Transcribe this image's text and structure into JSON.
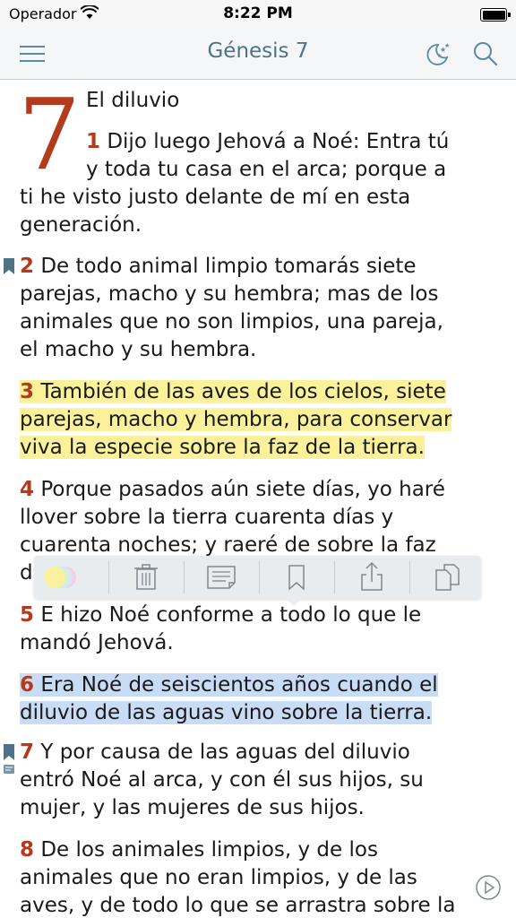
{
  "status_bar": {
    "carrier": "Operador",
    "time": "8:22 PM"
  },
  "navbar": {
    "title": "Génesis 7"
  },
  "chapter": {
    "number": "7",
    "heading": "El diluvio"
  },
  "verses": [
    {
      "num": "1",
      "lines": [
        "Dijo luego Jehová a Noé: Entra tú",
        "y toda tu casa en el arca; porque a",
        "ti he visto justo delante de mí en esta",
        "generación."
      ]
    },
    {
      "num": "2",
      "lines": [
        "De todo animal limpio tomarás siete",
        "parejas, macho y su hembra; mas de los",
        "animales que no son limpios, una pareja,",
        "el macho y su hembra."
      ]
    },
    {
      "num": "3",
      "lines": [
        "También de las aves de los cielos, siete",
        "parejas, macho y hembra, para conservar",
        "viva la especie sobre la faz de la tierra."
      ]
    },
    {
      "num": "4",
      "lines": [
        "Porque pasados aún siete días, yo haré",
        "llover sobre la tierra cuarenta días y",
        "cuarenta noches; y raeré de sobre la faz",
        "d"
      ]
    },
    {
      "num": "5",
      "lines": [
        "E hizo Noé conforme a todo lo que le",
        "mandó Jehová."
      ]
    },
    {
      "num": "6",
      "lines": [
        "Era Noé de seiscientos años cuando el",
        "diluvio de las aguas vino sobre la tierra."
      ]
    },
    {
      "num": "7",
      "lines": [
        "Y por causa de las aguas del diluvio",
        "entró Noé al arca, y con él sus hijos, su",
        "mujer, y las mujeres de sus hijos."
      ]
    },
    {
      "num": "8",
      "lines": [
        "De los animales limpios, y de los",
        "animales que no eran limpios, y de las",
        "aves, y de todo lo que se arrastra sobre la"
      ]
    }
  ],
  "popup_toolbar": {
    "items": [
      {
        "name": "highlight-color-icon"
      },
      {
        "name": "trash-icon"
      },
      {
        "name": "note-icon"
      },
      {
        "name": "bookmark-icon"
      },
      {
        "name": "share-icon"
      },
      {
        "name": "copy-icon"
      }
    ]
  },
  "colors": {
    "accent": "#5a8aa6",
    "verse_number": "#b43a1e",
    "highlight_yellow": "#fbf19a",
    "highlight_blue": "#c8dcf6"
  }
}
